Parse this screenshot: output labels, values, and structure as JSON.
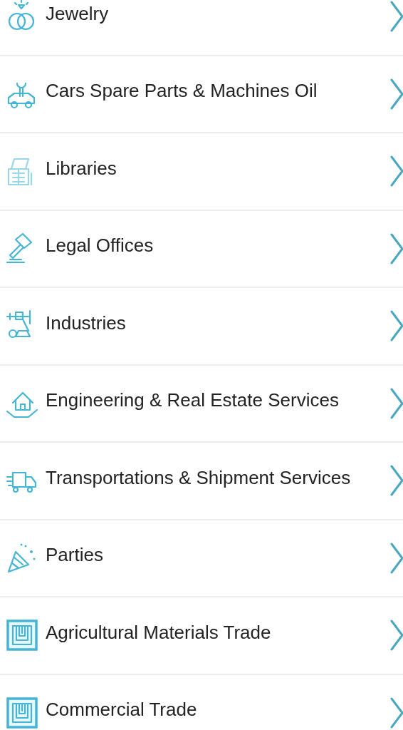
{
  "categories": [
    {
      "label": "Jewelry",
      "kind": "rings"
    },
    {
      "label": "Cars Spare Parts & Machines Oil",
      "kind": "car"
    },
    {
      "label": "Libraries",
      "kind": "books"
    },
    {
      "label": "Legal Offices",
      "kind": "gavel"
    },
    {
      "label": "Industries",
      "kind": "robot"
    },
    {
      "label": "Engineering & Real Estate Services",
      "kind": "house"
    },
    {
      "label": "Transportations & Shipment Services",
      "kind": "truck"
    },
    {
      "label": "Parties",
      "kind": "confetti"
    },
    {
      "label": "Agricultural Materials Trade",
      "kind": "maze"
    },
    {
      "label": "Commercial Trade",
      "kind": "maze"
    }
  ]
}
